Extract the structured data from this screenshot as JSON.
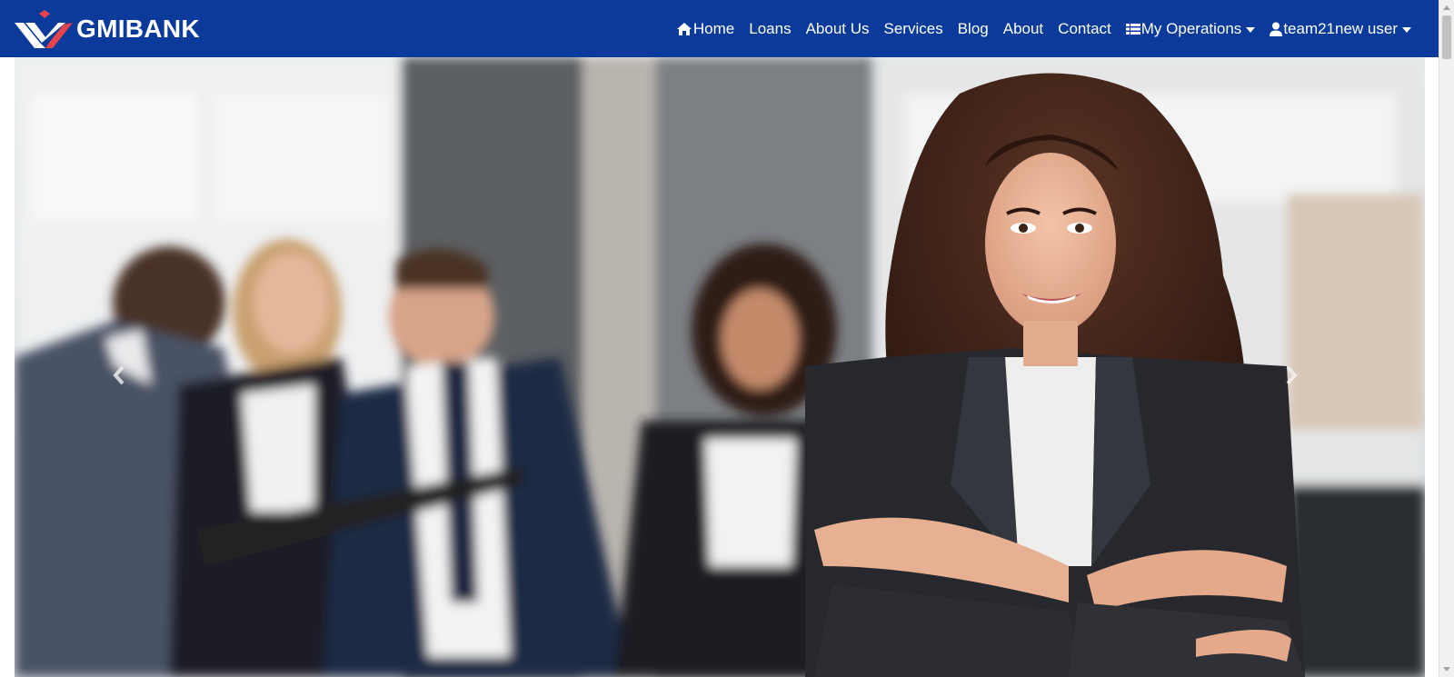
{
  "brand": {
    "name": "GMIBANK",
    "logo_icon": "gmibank-logo-icon"
  },
  "nav": {
    "items": [
      {
        "label": "Home",
        "icon": "home-icon"
      },
      {
        "label": "Loans"
      },
      {
        "label": "About Us"
      },
      {
        "label": "Services"
      },
      {
        "label": "Blog"
      },
      {
        "label": "About"
      },
      {
        "label": "Contact"
      },
      {
        "label": "My Operations",
        "icon": "table-list-icon",
        "dropdown": true
      },
      {
        "label": "team21new user",
        "icon": "user-icon",
        "dropdown": true
      }
    ]
  },
  "carousel": {
    "image": "business-team-woman-crossed-arms-photo",
    "prev_icon": "chevron-left-icon",
    "next_icon": "chevron-right-icon"
  },
  "colors": {
    "navbar_bg": "#0a3a9a",
    "nav_text": "#ffffff",
    "logo_red": "#e8424d"
  }
}
